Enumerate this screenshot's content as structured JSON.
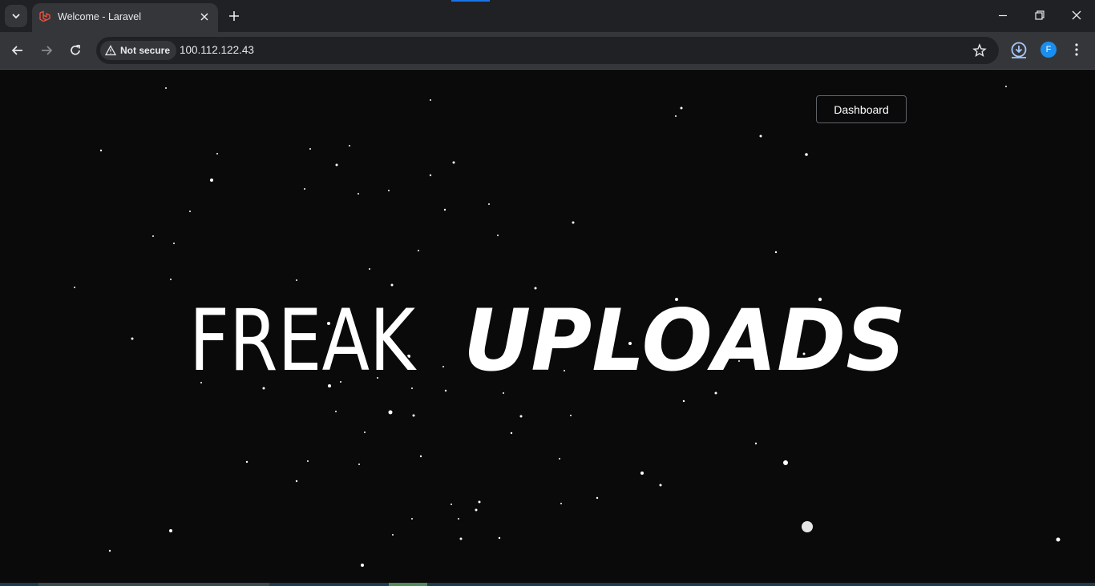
{
  "browser": {
    "tab": {
      "title": "Welcome - Laravel"
    },
    "security_chip": "Not secure",
    "url": "100.112.122.43",
    "profile_initial": "F"
  },
  "page": {
    "dashboard_label": "Dashboard",
    "hero": {
      "word1": "FREAK",
      "word2": "UPLOADS"
    }
  },
  "colors": {
    "background": "#0a0a0b",
    "text": "#ffffff",
    "accent": "#1a73e8"
  }
}
